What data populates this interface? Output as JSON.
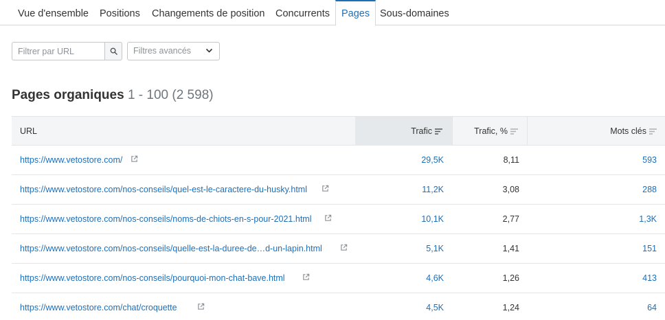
{
  "tabs": [
    {
      "label": "Vue d'ensemble"
    },
    {
      "label": "Positions"
    },
    {
      "label": "Changements de position"
    },
    {
      "label": "Concurrents"
    },
    {
      "label": "Pages"
    },
    {
      "label": "Sous-domaines"
    }
  ],
  "filters": {
    "url_placeholder": "Filtrer par URL",
    "advanced_label": "Filtres avancés"
  },
  "section": {
    "title": "Pages organiques",
    "range": "1 - 100 (2 598)"
  },
  "table": {
    "headers": {
      "url": "URL",
      "traffic": "Trafic",
      "traffic_pct": "Trafic, %",
      "keywords": "Mots clés"
    },
    "rows": [
      {
        "url": "https://www.vetostore.com/",
        "traffic": "29,5K",
        "traffic_pct": "8,11",
        "keywords": "593"
      },
      {
        "url": "https://www.vetostore.com/nos-conseils/quel-est-le-caractere-du-husky.html",
        "traffic": "11,2K",
        "traffic_pct": "3,08",
        "keywords": "288"
      },
      {
        "url": "https://www.vetostore.com/nos-conseils/noms-de-chiots-en-s-pour-2021.html",
        "traffic": "10,1K",
        "traffic_pct": "2,77",
        "keywords": "1,3K"
      },
      {
        "url": "https://www.vetostore.com/nos-conseils/quelle-est-la-duree-de…d-un-lapin.html",
        "traffic": "5,1K",
        "traffic_pct": "1,41",
        "keywords": "151"
      },
      {
        "url": "https://www.vetostore.com/nos-conseils/pourquoi-mon-chat-bave.html",
        "traffic": "4,6K",
        "traffic_pct": "1,26",
        "keywords": "413"
      },
      {
        "url": "https://www.vetostore.com/chat/croquette",
        "traffic": "4,5K",
        "traffic_pct": "1,24",
        "keywords": "64"
      }
    ]
  },
  "colors": {
    "link": "#1d6fb8",
    "active_tab": "#1d6fb8",
    "header_bg": "#f4f5f6",
    "sorted_bg": "#e6e9eb"
  }
}
